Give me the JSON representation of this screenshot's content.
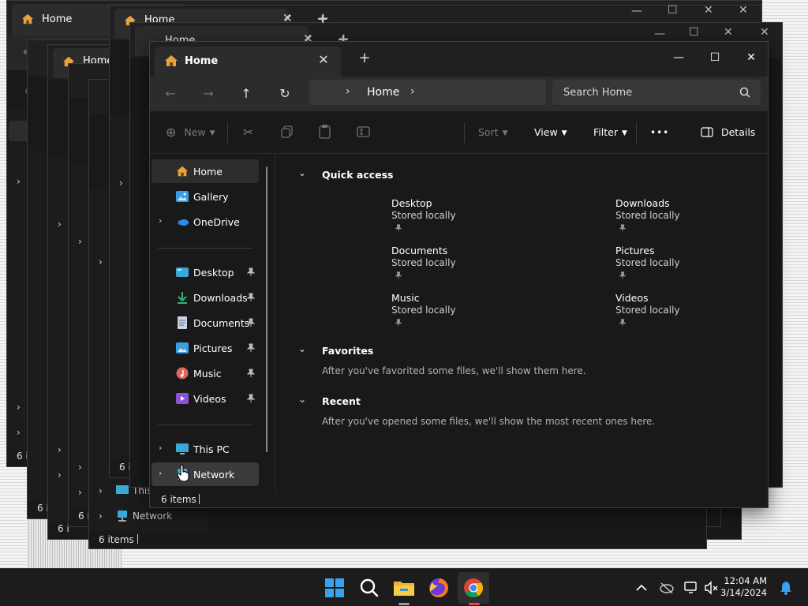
{
  "window": {
    "tab_title": "Home",
    "new_tab_label": "+",
    "close_tab_label": "✕",
    "minimize_label": "—",
    "maximize_label": "☐",
    "close_label": "✕"
  },
  "ghost_windows": {
    "tab_title": "Home",
    "status": "6 items",
    "sidebar_network": "Network",
    "sidebar_thispc": "This PC"
  },
  "navigation": {
    "back_label": "←",
    "forward_label": "→",
    "up_label": "↑",
    "refresh_label": "↻",
    "breadcrumb": "Home",
    "search_placeholder": "Search Home"
  },
  "toolbar": {
    "new_label": "New",
    "sort_label": "Sort",
    "view_label": "View",
    "filter_label": "Filter",
    "more_label": "•••",
    "details_label": "Details"
  },
  "sidebar": {
    "home": "Home",
    "gallery": "Gallery",
    "onedrive": "OneDrive",
    "desktop": "Desktop",
    "downloads": "Downloads",
    "documents": "Documents",
    "pictures": "Pictures",
    "music": "Music",
    "videos": "Videos",
    "this_pc": "This PC",
    "network": "Network"
  },
  "content": {
    "quick_access_title": "Quick access",
    "quick_access": [
      {
        "name": "Desktop",
        "sub": "Stored locally"
      },
      {
        "name": "Downloads",
        "sub": "Stored locally"
      },
      {
        "name": "Documents",
        "sub": "Stored locally"
      },
      {
        "name": "Pictures",
        "sub": "Stored locally"
      },
      {
        "name": "Music",
        "sub": "Stored locally"
      },
      {
        "name": "Videos",
        "sub": "Stored locally"
      }
    ],
    "favorites_title": "Favorites",
    "favorites_note": "After you've favorited some files, we'll show them here.",
    "recent_title": "Recent",
    "recent_note": "After you've opened some files, we'll show the most recent ones here."
  },
  "status": {
    "items": "6 items"
  },
  "taskbar": {
    "time": "12:04 AM",
    "date": "3/14/2024"
  },
  "colors": {
    "accent_home": "#e8a33c",
    "folder_blue": "#3a9ee0",
    "downloads_green": "#2fb57a",
    "music_red": "#e0655a",
    "videos_purple": "#8a52d6"
  }
}
